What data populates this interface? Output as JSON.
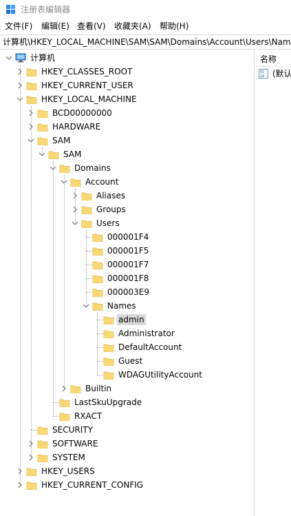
{
  "window": {
    "title": "注册表编辑器"
  },
  "menu": [
    "文件(F)",
    "编辑(E)",
    "查看(V)",
    "收藏夹(A)",
    "帮助(H)"
  ],
  "address": "计算机\\HKEY_LOCAL_MACHINE\\SAM\\SAM\\Domains\\Account\\Users\\Names\\admin",
  "right_pane": {
    "column_name": "名称",
    "values": [
      {
        "name": "(默认)"
      }
    ]
  },
  "tree": [
    {
      "label": "计算机",
      "level": 0,
      "state": "expanded",
      "icon": "computer-icon"
    },
    {
      "label": "HKEY_CLASSES_ROOT",
      "level": 1,
      "state": "collapsed"
    },
    {
      "label": "HKEY_CURRENT_USER",
      "level": 1,
      "state": "collapsed"
    },
    {
      "label": "HKEY_LOCAL_MACHINE",
      "level": 1,
      "state": "expanded"
    },
    {
      "label": "BCD00000000",
      "level": 2,
      "state": "collapsed"
    },
    {
      "label": "HARDWARE",
      "level": 2,
      "state": "collapsed"
    },
    {
      "label": "SAM",
      "level": 2,
      "state": "expanded"
    },
    {
      "label": "SAM",
      "level": 3,
      "state": "expanded"
    },
    {
      "label": "Domains",
      "level": 4,
      "state": "expanded"
    },
    {
      "label": "Account",
      "level": 5,
      "state": "expanded"
    },
    {
      "label": "Aliases",
      "level": 6,
      "state": "collapsed"
    },
    {
      "label": "Groups",
      "level": 6,
      "state": "collapsed"
    },
    {
      "label": "Users",
      "level": 6,
      "state": "expanded"
    },
    {
      "label": "000001F4",
      "level": 7,
      "state": "leaf"
    },
    {
      "label": "000001F5",
      "level": 7,
      "state": "leaf"
    },
    {
      "label": "000001F7",
      "level": 7,
      "state": "leaf"
    },
    {
      "label": "000001F8",
      "level": 7,
      "state": "leaf"
    },
    {
      "label": "000003E9",
      "level": 7,
      "state": "leaf"
    },
    {
      "label": "Names",
      "level": 7,
      "state": "expanded"
    },
    {
      "label": "admin",
      "level": 8,
      "state": "leaf",
      "selected": true
    },
    {
      "label": "Administrator",
      "level": 8,
      "state": "leaf"
    },
    {
      "label": "DefaultAccount",
      "level": 8,
      "state": "leaf"
    },
    {
      "label": "Guest",
      "level": 8,
      "state": "leaf"
    },
    {
      "label": "WDAGUtilityAccount",
      "level": 8,
      "state": "leaf"
    },
    {
      "label": "Builtin",
      "level": 5,
      "state": "collapsed"
    },
    {
      "label": "LastSkuUpgrade",
      "level": 4,
      "state": "leaf"
    },
    {
      "label": "RXACT",
      "level": 4,
      "state": "leaf"
    },
    {
      "label": "SECURITY",
      "level": 2,
      "state": "leaf"
    },
    {
      "label": "SOFTWARE",
      "level": 2,
      "state": "collapsed"
    },
    {
      "label": "SYSTEM",
      "level": 2,
      "state": "collapsed"
    },
    {
      "label": "HKEY_USERS",
      "level": 1,
      "state": "collapsed"
    },
    {
      "label": "HKEY_CURRENT_CONFIG",
      "level": 1,
      "state": "collapsed"
    }
  ],
  "colors": {
    "folder_fill": "#f8d775",
    "folder_edge": "#e0b341",
    "selection": "#d9d9d9",
    "chevron": "#808080"
  }
}
